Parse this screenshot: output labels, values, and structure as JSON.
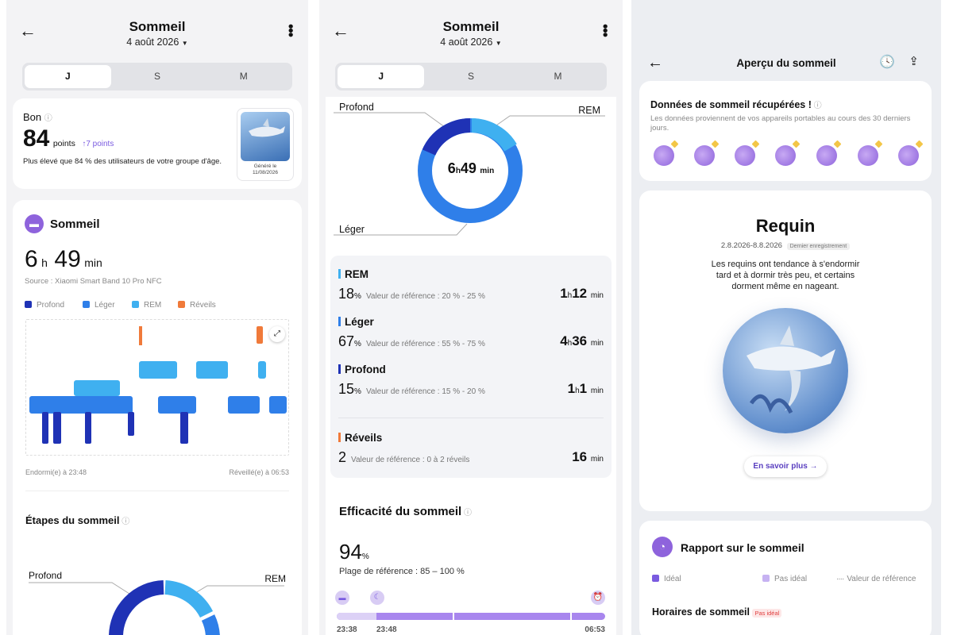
{
  "screen1": {
    "title": "Sommeil",
    "date": "4 août 2026",
    "tabs": [
      "J",
      "S",
      "M"
    ],
    "score": {
      "rating": "Bon",
      "value": "84",
      "unit": "points",
      "delta": "7 points",
      "comparison": "Plus élevé que 84 % des utilisateurs de votre groupe d'âge.",
      "badge_caption": "Généré le 11/08/2026"
    },
    "sleep": {
      "heading": "Sommeil",
      "hours": "6",
      "h": "h",
      "minutes": "49",
      "min": "min",
      "source": "Source : Xiaomi Smart Band 10 Pro NFC",
      "legend": [
        "Profond",
        "Léger",
        "REM",
        "Réveils"
      ],
      "asleep": "Endormi(e) à 23:48",
      "awake": "Réveillé(e) à 06:53"
    },
    "stages_heading": "Étapes du sommeil",
    "donut_labels": {
      "left": "Profond",
      "right": "REM"
    }
  },
  "screen2": {
    "title": "Sommeil",
    "date": "4 août 2026",
    "tabs": [
      "J",
      "S",
      "M"
    ],
    "donut": {
      "label_deep": "Profond",
      "label_rem": "REM",
      "label_light": "Léger",
      "center_h": "6",
      "center_hunit": "h",
      "center_m": "49",
      "center_munit": "min"
    },
    "stages": [
      {
        "name": "REM",
        "pct": "18",
        "ref": "Valeur de référence : 20 % - 25 %",
        "h": "1",
        "m": "12",
        "color": "#3fb0f0"
      },
      {
        "name": "Léger",
        "pct": "67",
        "ref": "Valeur de référence : 55 % - 75 %",
        "h": "4",
        "m": "36",
        "color": "#2f7fe9"
      },
      {
        "name": "Profond",
        "pct": "15",
        "ref": "Valeur de référence : 15 % - 20 %",
        "h": "1",
        "m": "1",
        "color": "#1f32b5"
      }
    ],
    "wake": {
      "name": "Réveils",
      "count": "2",
      "ref": "Valeur de référence : 0 à 2 réveils",
      "dur": "16",
      "unit": "min",
      "color": "#f07a3a"
    },
    "efficiency": {
      "heading": "Efficacité du sommeil",
      "value": "94",
      "unit": "%",
      "range": "Plage de référence : 85 – 100 %",
      "t_start": "23:38",
      "t_sleep": "23:48",
      "t_end": "06:53"
    }
  },
  "screen3": {
    "title": "Aperçu du sommeil",
    "recovered": {
      "heading": "Données de sommeil récupérées !",
      "desc": "Les données proviennent de vos appareils portables au cours des 30 derniers jours."
    },
    "animal": {
      "name": "Requin",
      "range": "2.8.2026-8.8.2026",
      "tag": "Dernier enregistrement",
      "desc": "Les requins ont tendance à s'endormir tard et à dormir très peu, et certains dorment même en nageant.",
      "button": "En savoir plus →"
    },
    "report": {
      "heading": "Rapport sur le sommeil",
      "legend_ideal": "Idéal",
      "legend_not_ideal": "Pas idéal",
      "legend_ref": "Valeur de référence",
      "schedule": "Horaires de sommeil",
      "schedule_tag": "Pas idéal"
    }
  },
  "colors": {
    "deep": "#1f32b5",
    "light": "#2f7fe9",
    "rem": "#3fb0f0",
    "wake": "#f07a3a",
    "accent": "#8e63dc"
  }
}
